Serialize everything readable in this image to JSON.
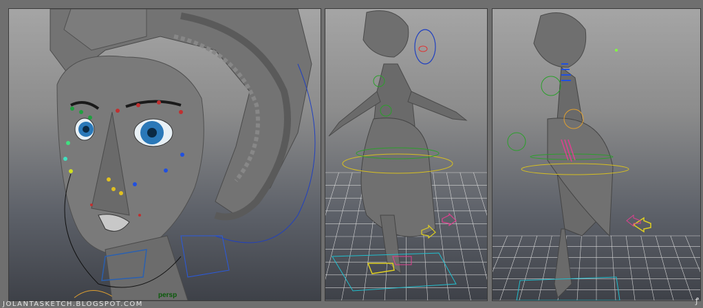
{
  "viewports": {
    "persp": {
      "camera_label": "persp"
    },
    "front": {
      "camera_label": ""
    },
    "side": {
      "camera_label": ""
    }
  },
  "footer": {
    "watermark": "JOLANTASKETCH.BLOGSPOT.COM",
    "logo_glyph": "ꝭ"
  },
  "colors": {
    "background": "#6f6f6f",
    "model_gray": "#6e6e6e",
    "grid": "#d8d8d8",
    "control_green": "#2aa02a",
    "control_yellow": "#d8c020",
    "control_pink": "#e04090",
    "control_blue": "#2060e0",
    "control_cyan": "#20c0d0"
  }
}
